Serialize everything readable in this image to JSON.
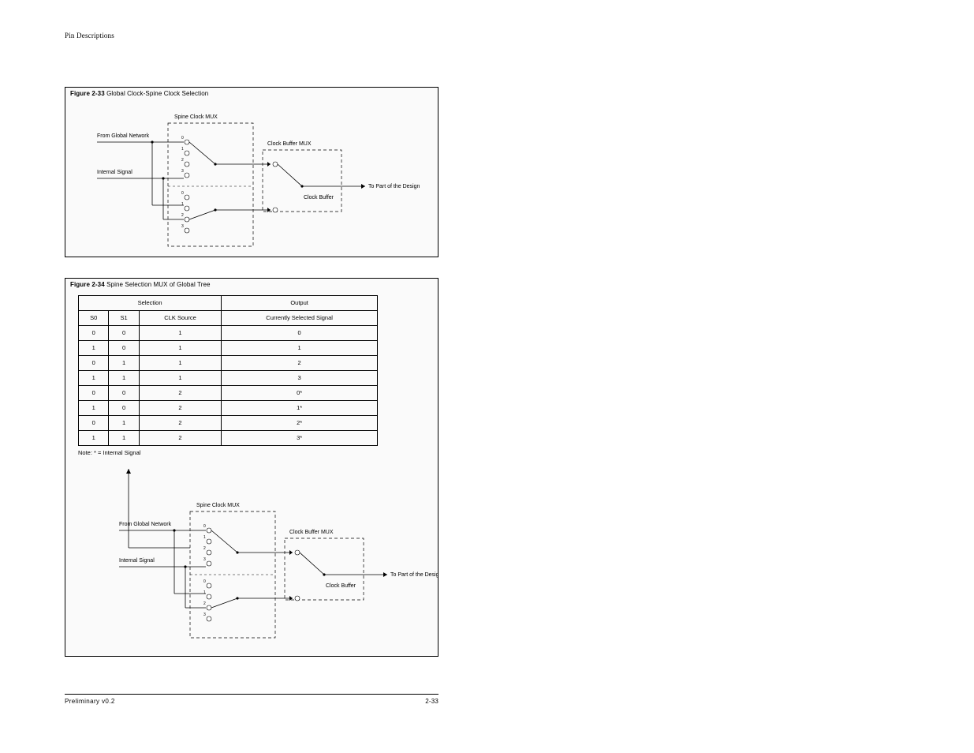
{
  "header_text": "Pin Descriptions",
  "figure_a": {
    "caption_prefix": "Figure 2-33",
    "caption": "Global Clock-Spine Clock Selection",
    "label_left_top": "From Global Network",
    "label_left_bot": "Internal Signal",
    "label_top_mux": "Spine Clock MUX",
    "label_right_mux": "Clock Buffer MUX",
    "label_right_caption": "Clock Buffer",
    "out_label": "To Part of the Design",
    "terminals": [
      "0",
      "1",
      "2",
      "3",
      "0",
      "1",
      "2",
      "3"
    ]
  },
  "figure_b": {
    "caption_prefix": "Figure 2-34",
    "caption": "Spine Selection MUX of Global Tree",
    "label_left_top": "From Global Network",
    "label_left_bot": "Internal Signal",
    "label_top_mux": "Spine Clock MUX",
    "label_right_mux": "Clock Buffer MUX",
    "label_right_caption": "Clock Buffer",
    "out_label": "To Part of the Design",
    "terminals": [
      "0",
      "1",
      "2",
      "3",
      "0",
      "1",
      "2",
      "3"
    ],
    "table_note": "Note: * = Internal Signal",
    "truth": {
      "head": {
        "sel": "Selection",
        "out": "Output"
      },
      "sub": {
        "s0": "S0",
        "s1": "S1",
        "clk": "CLK Source",
        "sig": "Currently Selected Signal"
      },
      "rows": [
        {
          "s0": "0",
          "s1": "0",
          "clk": "1",
          "sig": "0"
        },
        {
          "s0": "1",
          "s1": "0",
          "clk": "1",
          "sig": "1"
        },
        {
          "s0": "0",
          "s1": "1",
          "clk": "1",
          "sig": "2"
        },
        {
          "s0": "1",
          "s1": "1",
          "clk": "1",
          "sig": "3"
        },
        {
          "s0": "0",
          "s1": "0",
          "clk": "2",
          "sig": "0*"
        },
        {
          "s0": "1",
          "s1": "0",
          "clk": "2",
          "sig": "1*"
        },
        {
          "s0": "0",
          "s1": "1",
          "clk": "2",
          "sig": "2*"
        },
        {
          "s0": "1",
          "s1": "1",
          "clk": "2",
          "sig": "3*"
        }
      ]
    }
  },
  "footer": {
    "left": "Preliminary v0.2",
    "right": "2-33"
  }
}
